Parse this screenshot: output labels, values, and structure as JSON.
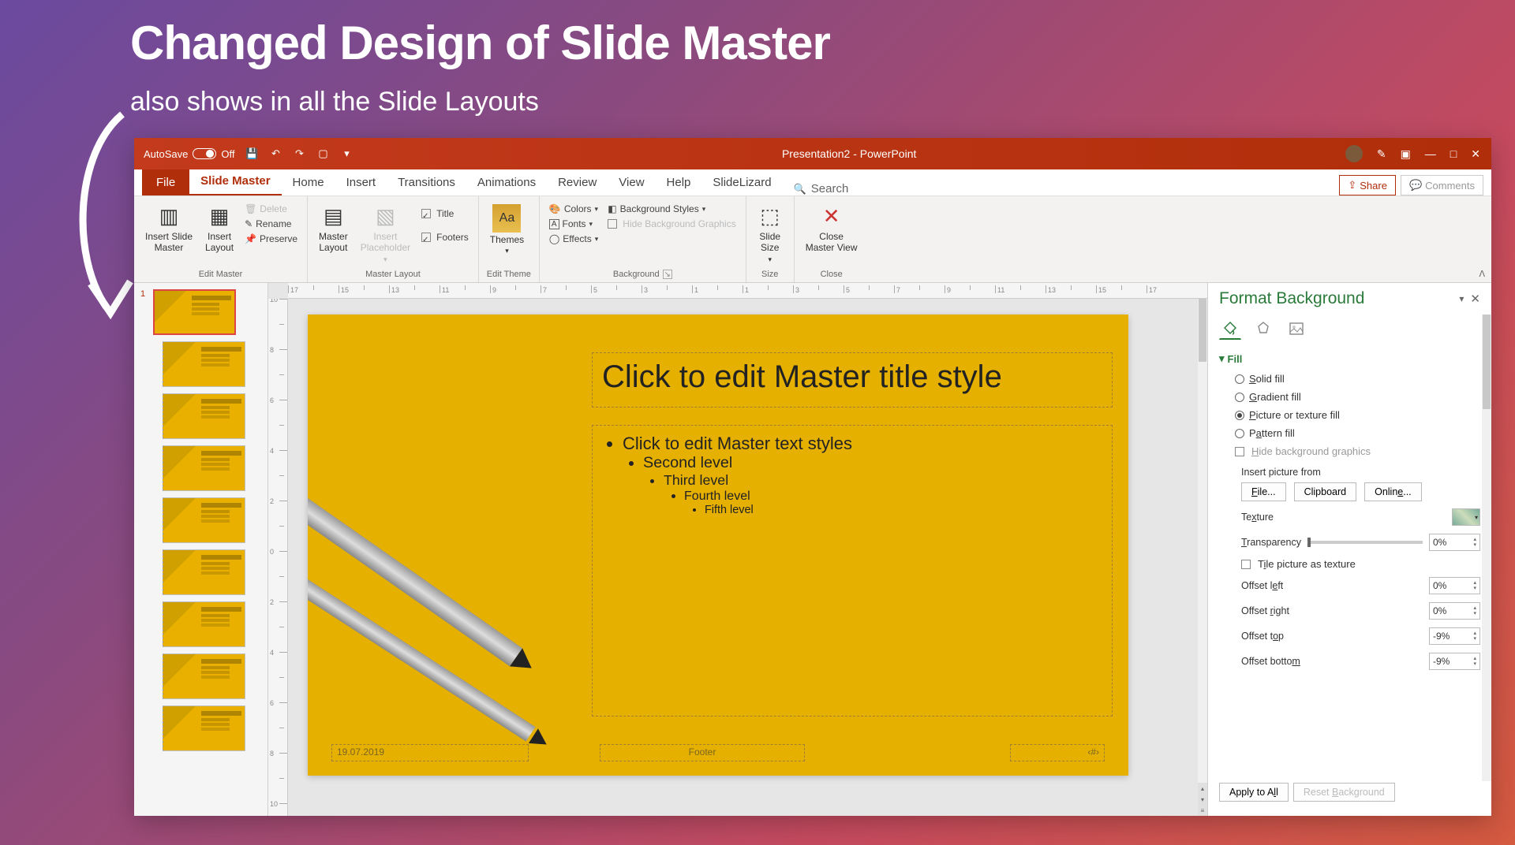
{
  "annotation": {
    "title": "Changed Design of Slide Master",
    "subtitle": "also shows in all the Slide Layouts"
  },
  "titlebar": {
    "autosave_label": "AutoSave",
    "autosave_state": "Off",
    "doc_title": "Presentation2  -  PowerPoint"
  },
  "tabs": {
    "file": "File",
    "slide_master": "Slide Master",
    "home": "Home",
    "insert": "Insert",
    "transitions": "Transitions",
    "animations": "Animations",
    "review": "Review",
    "view": "View",
    "help": "Help",
    "slidelizard": "SlideLizard",
    "search": "Search",
    "share": "Share",
    "comments": "Comments"
  },
  "ribbon": {
    "insert_slide_master": "Insert Slide\nMaster",
    "insert_layout": "Insert\nLayout",
    "delete": "Delete",
    "rename": "Rename",
    "preserve": "Preserve",
    "grp_edit_master": "Edit Master",
    "master_layout": "Master\nLayout",
    "insert_placeholder": "Insert\nPlaceholder",
    "chk_title": "Title",
    "chk_footers": "Footers",
    "grp_master_layout": "Master Layout",
    "themes": "Themes",
    "grp_edit_theme": "Edit Theme",
    "colors": "Colors",
    "fonts": "Fonts",
    "effects": "Effects",
    "bg_styles": "Background Styles",
    "hide_bg": "Hide Background Graphics",
    "grp_background": "Background",
    "slide_size": "Slide\nSize",
    "grp_size": "Size",
    "close_master": "Close\nMaster View",
    "grp_close": "Close"
  },
  "slide": {
    "title_ph": "Click to edit Master title style",
    "bullets": [
      "Click to edit Master text styles",
      "Second level",
      "Third level",
      "Fourth level",
      "Fifth level"
    ],
    "date": "19.07.2019",
    "footer": "Footer",
    "num_icon": "‹#›"
  },
  "thumbs": {
    "master_num": "1"
  },
  "format_pane": {
    "title": "Format Background",
    "section_fill": "Fill",
    "solid": "Solid fill",
    "gradient": "Gradient fill",
    "picture": "Picture or texture fill",
    "pattern": "Pattern fill",
    "hide_bg": "Hide background graphics",
    "insert_from": "Insert picture from",
    "btn_file": "File...",
    "btn_clipboard": "Clipboard",
    "btn_online": "Online...",
    "texture": "Texture",
    "transparency": "Transparency",
    "transparency_val": "0%",
    "tile": "Tile picture as texture",
    "offset_left": "Offset left",
    "offset_left_val": "0%",
    "offset_right": "Offset right",
    "offset_right_val": "0%",
    "offset_top": "Offset top",
    "offset_top_val": "-9%",
    "offset_bottom": "Offset bottom",
    "offset_bottom_val": "-9%",
    "apply_all": "Apply to All",
    "reset_bg": "Reset Background"
  }
}
